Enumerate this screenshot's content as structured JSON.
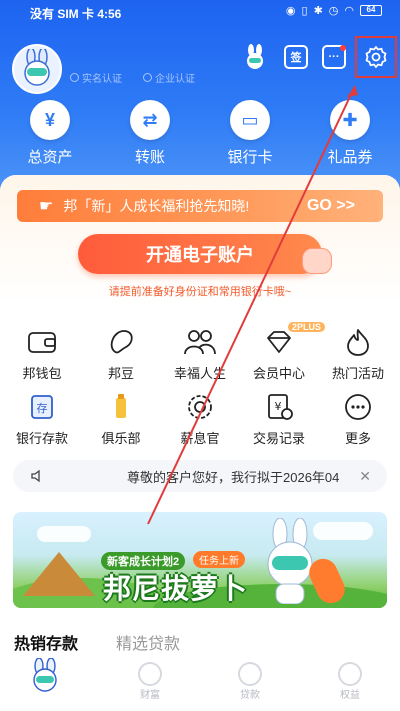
{
  "status_bar": {
    "left": "没有 SIM 卡 4:56",
    "right_icons": [
      "eye-icon",
      "vibrate-icon",
      "bluetooth-icon",
      "alarm-icon",
      "wifi-icon"
    ],
    "battery": "64"
  },
  "profile": {
    "real_name_cert": "实名认证",
    "enterprise_cert": "企业认证"
  },
  "header_icons": {
    "sign_in_label": "签"
  },
  "quick_menu": [
    {
      "label": "总资产",
      "icon": "money-bag-icon"
    },
    {
      "label": "转账",
      "icon": "transfer-icon"
    },
    {
      "label": "银行卡",
      "icon": "card-icon"
    },
    {
      "label": "礼品券",
      "icon": "gift-icon"
    }
  ],
  "promo": {
    "banner": "邦「新」人成长福利抢先知晓!",
    "go": "GO >>",
    "open_account": "开通电子账户",
    "note": "请提前准备好身份证和常用银行卡哦~"
  },
  "grid": {
    "row1": [
      {
        "label": "邦钱包",
        "icon": "wallet-icon"
      },
      {
        "label": "邦豆",
        "icon": "bean-icon"
      },
      {
        "label": "幸福人生",
        "icon": "family-icon"
      },
      {
        "label": "会员中心",
        "icon": "diamond-icon"
      },
      {
        "label": "热门活动",
        "icon": "fire-icon"
      }
    ],
    "row2": [
      {
        "label": "银行存款",
        "icon": "deposit-icon"
      },
      {
        "label": "俱乐部",
        "icon": "club-icon"
      },
      {
        "label": "薪息官",
        "icon": "gear-coin-icon"
      },
      {
        "label": "交易记录",
        "icon": "receipt-icon"
      },
      {
        "label": "更多",
        "icon": "more-icon"
      }
    ],
    "plus_tag": "2PLUS"
  },
  "notice": {
    "text": "尊敬的客户您好，我行拟于2026年04"
  },
  "campaign": {
    "subtitle": "新客成长计划2",
    "tag": "任务上新",
    "title": "邦尼拔萝卜"
  },
  "product_tabs": [
    "热销存款",
    "精选贷款"
  ],
  "bottom_nav": [
    {
      "label": "",
      "icon": "rabbit-mascot-icon"
    },
    {
      "label": "财富",
      "icon": "wealth-icon"
    },
    {
      "label": "贷款",
      "icon": "loan-icon"
    },
    {
      "label": "权益",
      "icon": "heart-icon"
    }
  ],
  "colors": {
    "primary": "#2f7cf6",
    "accent": "#ff6a3d",
    "highlight": "#e23b3b"
  }
}
